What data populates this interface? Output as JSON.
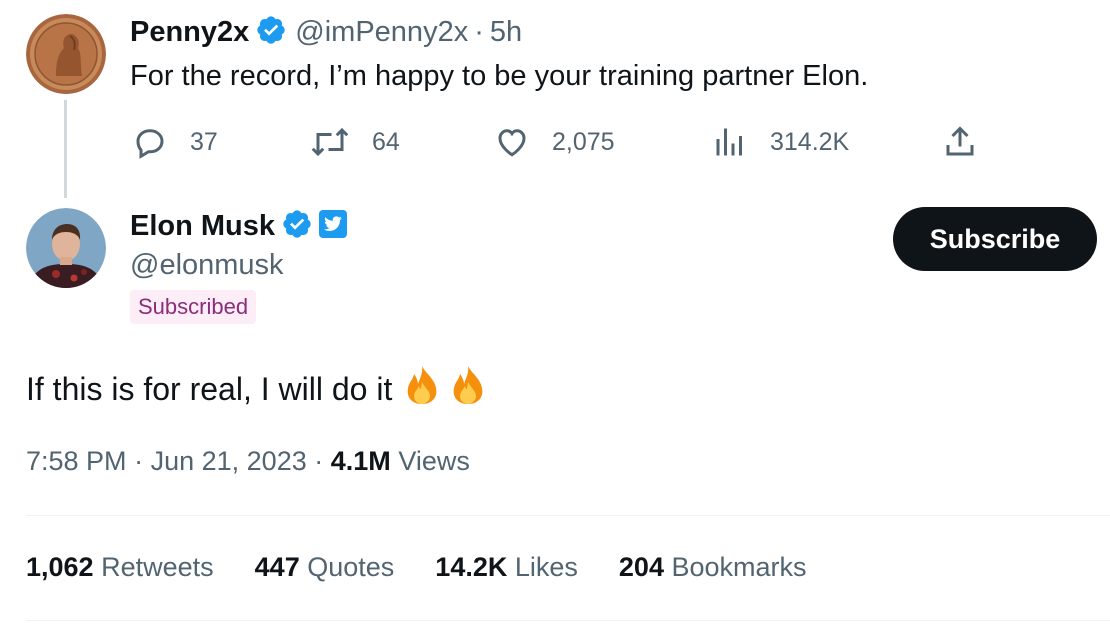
{
  "reply_tweet": {
    "display_name": "Penny2x",
    "handle": "@imPenny2x",
    "separator": "·",
    "age": "5h",
    "text": "For the record, I’m happy to be your training partner Elon.",
    "actions": {
      "replies": "37",
      "retweets": "64",
      "likes": "2,075",
      "views": "314.2K"
    },
    "icons": [
      "reply-icon",
      "retweet-icon",
      "like-icon",
      "views-icon",
      "share-icon"
    ]
  },
  "main_tweet": {
    "display_name": "Elon Musk",
    "handle": "@elonmusk",
    "subscribed_badge": "Subscribed",
    "subscribe_button": "Subscribe",
    "text": "If this is for real, I will do it",
    "emoji": [
      "🔥",
      "🔥"
    ],
    "time": "7:58 PM",
    "sep": "·",
    "date": "Jun 21, 2023",
    "views_count": "4.1M",
    "views_label": "Views"
  },
  "stats": [
    {
      "count": "1,062",
      "label": "Retweets"
    },
    {
      "count": "447",
      "label": "Quotes"
    },
    {
      "count": "14.2K",
      "label": "Likes"
    },
    {
      "count": "204",
      "label": "Bookmarks"
    }
  ],
  "colors": {
    "verified_blue": "#1d9bf0",
    "text_primary": "#0f1419",
    "text_secondary": "#536471",
    "subscribed_bg": "#fcedf7",
    "subscribed_text": "#8a2e7a"
  }
}
